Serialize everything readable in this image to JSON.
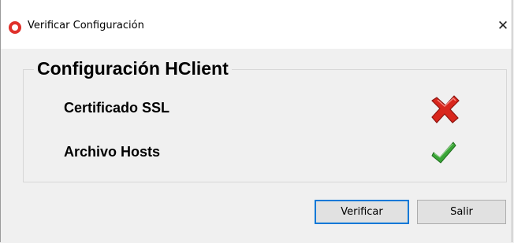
{
  "window": {
    "title": "Verificar Configuración",
    "close_glyph": "✕"
  },
  "group": {
    "title": "Configuración HClient",
    "rows": [
      {
        "label": "Certificado SSL",
        "status": "fail",
        "icon": "red-x-icon"
      },
      {
        "label": "Archivo Hosts",
        "status": "ok",
        "icon": "green-check-icon"
      }
    ]
  },
  "buttons": {
    "verify": "Verificar",
    "exit": "Salir"
  },
  "colors": {
    "fail": "#d9261c",
    "ok": "#3aa537",
    "accent": "#0078d7"
  }
}
